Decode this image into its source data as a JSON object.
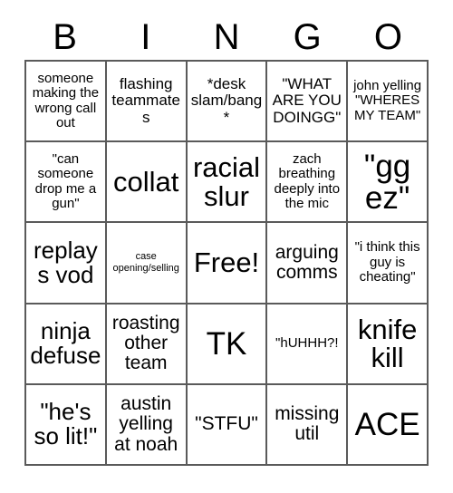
{
  "header": {
    "letters": [
      "B",
      "I",
      "N",
      "G",
      "O"
    ]
  },
  "grid": {
    "columns": 5,
    "rows": 5,
    "free_space_index": 12,
    "cells": [
      {
        "text": "someone making the wrong call out",
        "size": "fs-small"
      },
      {
        "text": "flashing teammates",
        "size": "fs-med"
      },
      {
        "text": "*desk slam/bang*",
        "size": "fs-med"
      },
      {
        "text": "\"WHAT ARE YOU DOINGG\"",
        "size": "fs-med"
      },
      {
        "text": "john yelling \"WHERES MY TEAM\"",
        "size": "fs-small"
      },
      {
        "text": "\"can someone drop me a gun\"",
        "size": "fs-small"
      },
      {
        "text": "collat",
        "size": "fs-xxl"
      },
      {
        "text": "racial slur",
        "size": "fs-xxl"
      },
      {
        "text": "zach breathing deeply into the mic",
        "size": "fs-small"
      },
      {
        "text": "\"gg ez\"",
        "size": "fs-huge"
      },
      {
        "text": "replays vod",
        "size": "fs-xl"
      },
      {
        "text": "case opening/selling",
        "size": "fs-tiny"
      },
      {
        "text": "Free!",
        "size": "fs-xxl"
      },
      {
        "text": "arguing comms",
        "size": "fs-large"
      },
      {
        "text": "\"i think this guy is cheating\"",
        "size": "fs-small"
      },
      {
        "text": "ninja defuse",
        "size": "fs-xl"
      },
      {
        "text": "roasting other team",
        "size": "fs-large"
      },
      {
        "text": "TK",
        "size": "fs-huge"
      },
      {
        "text": "\"hUHHH?!",
        "size": "fs-small"
      },
      {
        "text": "knife kill",
        "size": "fs-xxl"
      },
      {
        "text": "\"he's so lit!\"",
        "size": "fs-xl"
      },
      {
        "text": "austin yelling at noah",
        "size": "fs-large"
      },
      {
        "text": "\"STFU\"",
        "size": "fs-large"
      },
      {
        "text": "missing util",
        "size": "fs-large"
      },
      {
        "text": "ACE",
        "size": "fs-huge"
      }
    ]
  },
  "colors": {
    "background": "#ffffff",
    "text": "#000000",
    "grid_line": "#5a5a5a"
  }
}
